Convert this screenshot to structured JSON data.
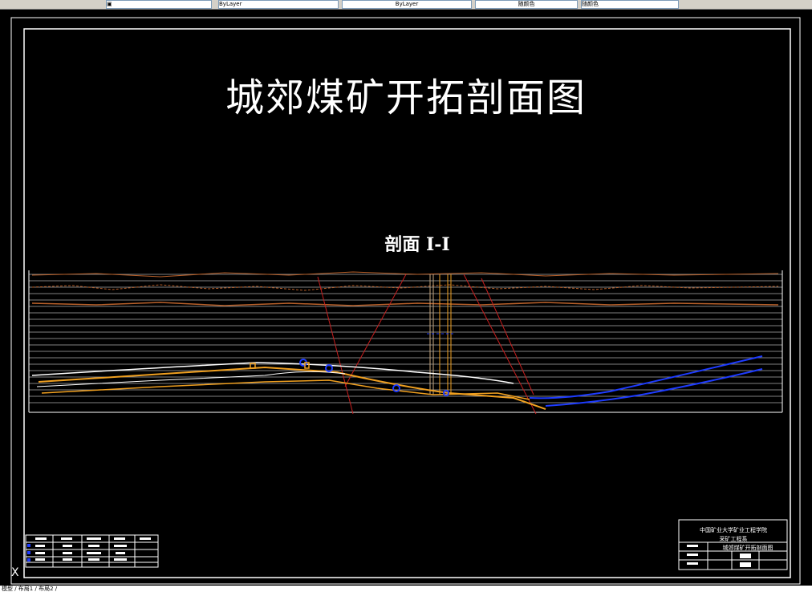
{
  "toolbar": {
    "items": [
      "ByLayer",
      "ByLayer",
      "随颜色",
      "随颜色"
    ]
  },
  "drawing": {
    "title": "城郊煤矿开拓剖面图",
    "section_label": "剖面  I-I"
  },
  "title_block": {
    "school": "中国矿业大学矿业工程学院",
    "major": "采矿工程系",
    "drawing_name": "城郊煤矿开拓剖面图"
  },
  "status": {
    "text": "模型 / 布局1 / 布局2 /"
  },
  "colors": {
    "background": "#000000",
    "frame": "#ffffff",
    "strata": "#b8602a",
    "coal_seam": "#f0a020",
    "roadway": "#1e3cff",
    "fault": "#c81e1e"
  }
}
